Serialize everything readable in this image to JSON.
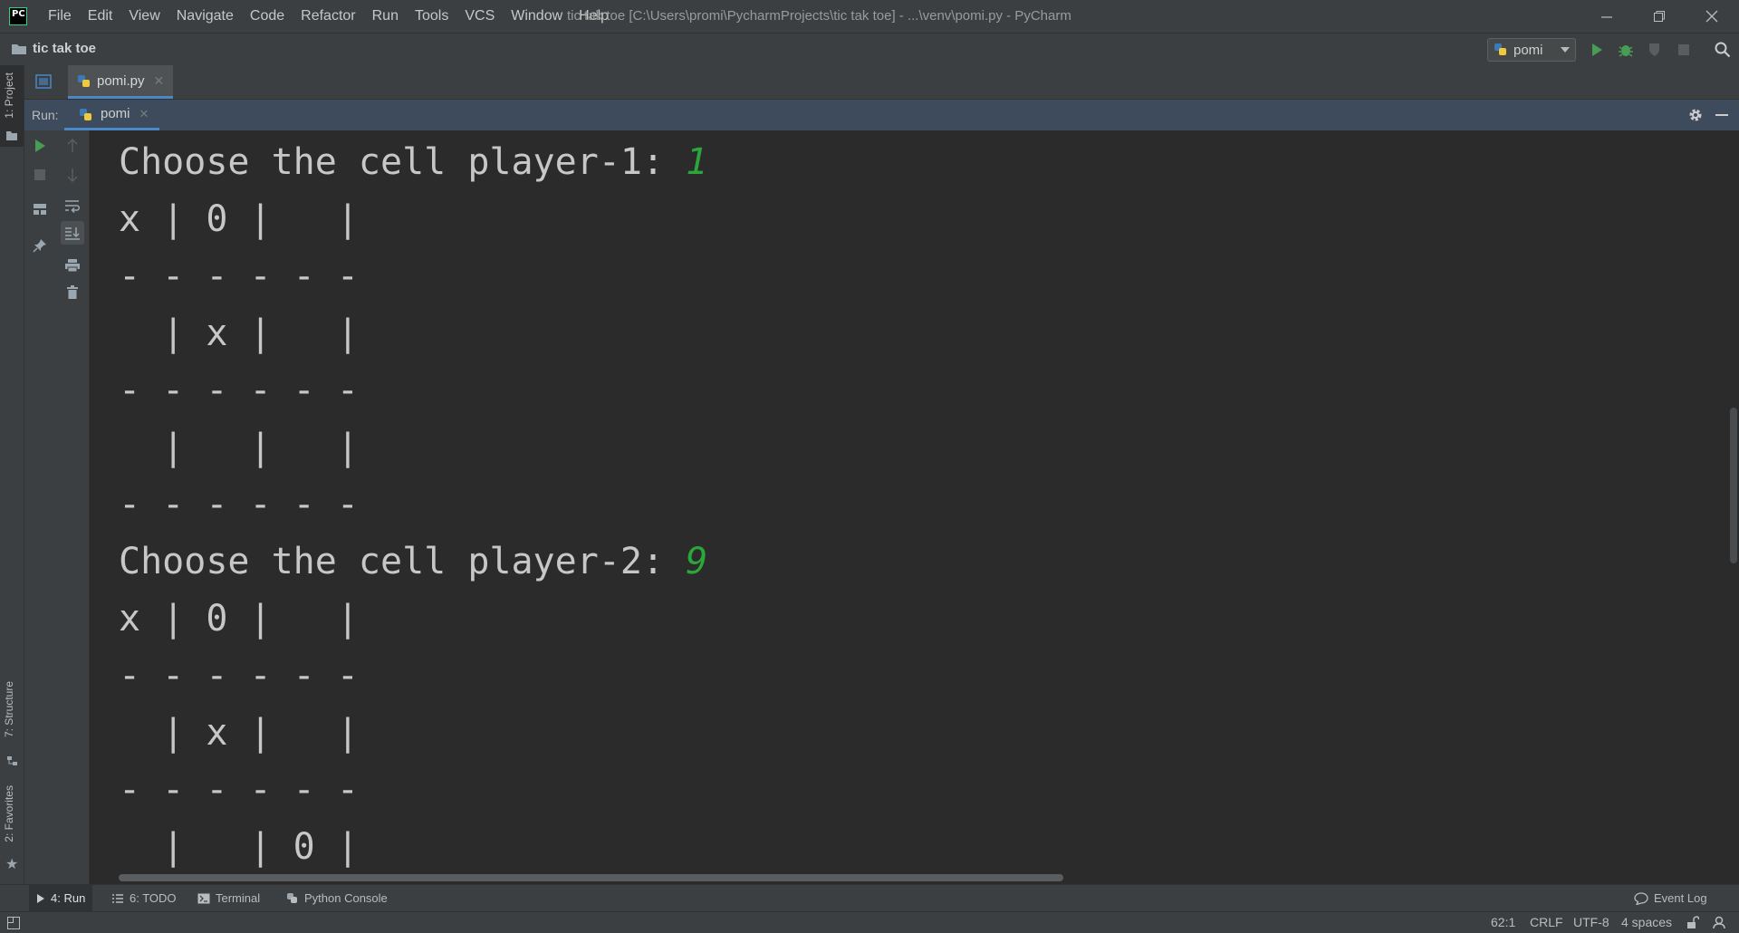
{
  "app": {
    "logo_text": "PC",
    "window_title": "tic tak toe [C:\\Users\\promi\\PycharmProjects\\tic tak toe] - ...\\venv\\pomi.py - PyCharm"
  },
  "menu": [
    "File",
    "Edit",
    "View",
    "Navigate",
    "Code",
    "Refactor",
    "Run",
    "Tools",
    "VCS",
    "Window",
    "Help"
  ],
  "navbar": {
    "project_name": "tic tak toe",
    "run_config": "pomi"
  },
  "left_stripe": {
    "project_tab": "1: Project",
    "structure_tab": "7: Structure",
    "favorites_tab": "2: Favorites"
  },
  "editor": {
    "file_tab": "pomi.py"
  },
  "run_panel": {
    "label": "Run:",
    "tab": "pomi"
  },
  "console": {
    "lines": [
      {
        "text": "Choose the cell player-1: ",
        "input": "1"
      },
      {
        "text": "x | 0 |   |"
      },
      {
        "text": "- - - - - -"
      },
      {
        "text": "  | x |   |"
      },
      {
        "text": "- - - - - -"
      },
      {
        "text": "  |   |   |"
      },
      {
        "text": "- - - - - -"
      },
      {
        "text": "Choose the cell player-2: ",
        "input": "9"
      },
      {
        "text": "x | 0 |   |"
      },
      {
        "text": "- - - - - -"
      },
      {
        "text": "  | x |   |"
      },
      {
        "text": "- - - - - -"
      },
      {
        "text": "  |   | 0 |"
      }
    ]
  },
  "bottom_tabs": {
    "run": "4: Run",
    "todo": "6: TODO",
    "terminal": "Terminal",
    "python_console": "Python Console",
    "event_log": "Event Log"
  },
  "status": {
    "position": "62:1",
    "line_sep": "CRLF",
    "encoding": "UTF-8",
    "indent": "4 spaces"
  },
  "colors": {
    "accent": "#4a88c7",
    "run_green": "#499c54",
    "input_green": "#2aa63a"
  }
}
